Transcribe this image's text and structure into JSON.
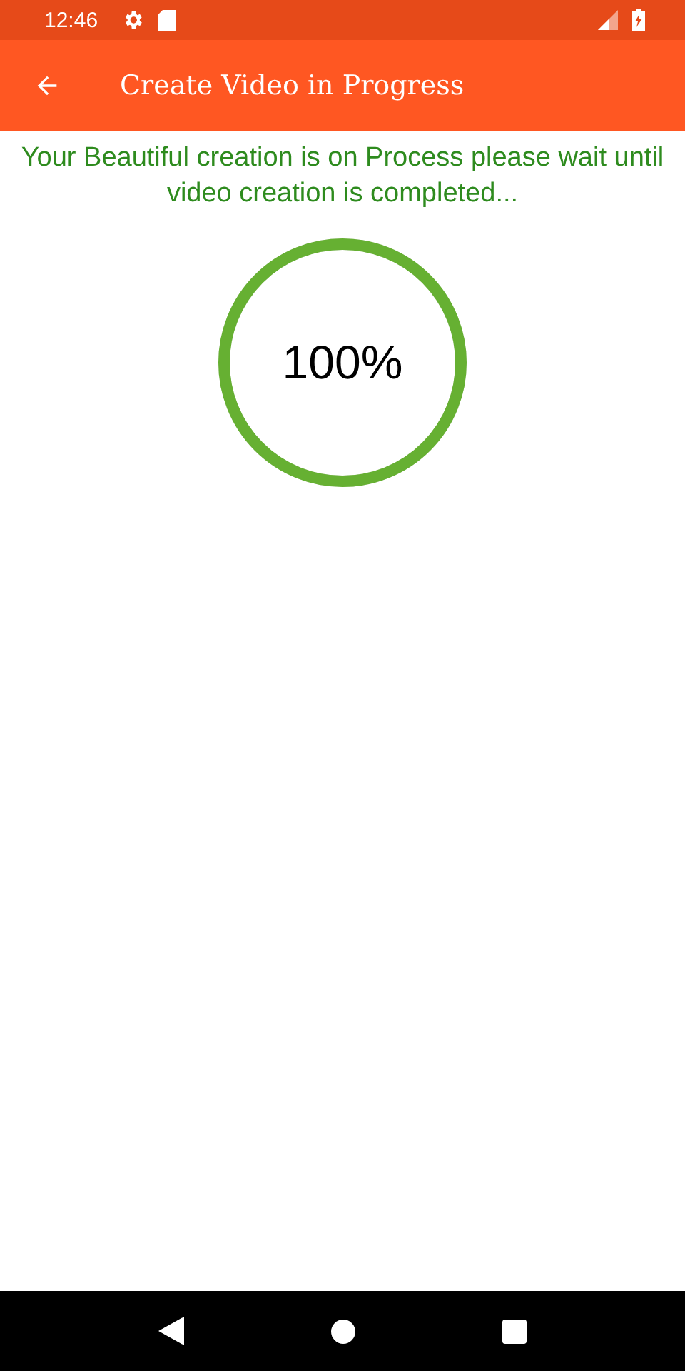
{
  "status_bar": {
    "time": "12:46"
  },
  "app_bar": {
    "title": "Create Video in Progress"
  },
  "message": "Your Beautiful creation is on Process please wait until video creation is completed...",
  "progress": {
    "level": 1,
    "reading": "100%"
  }
}
